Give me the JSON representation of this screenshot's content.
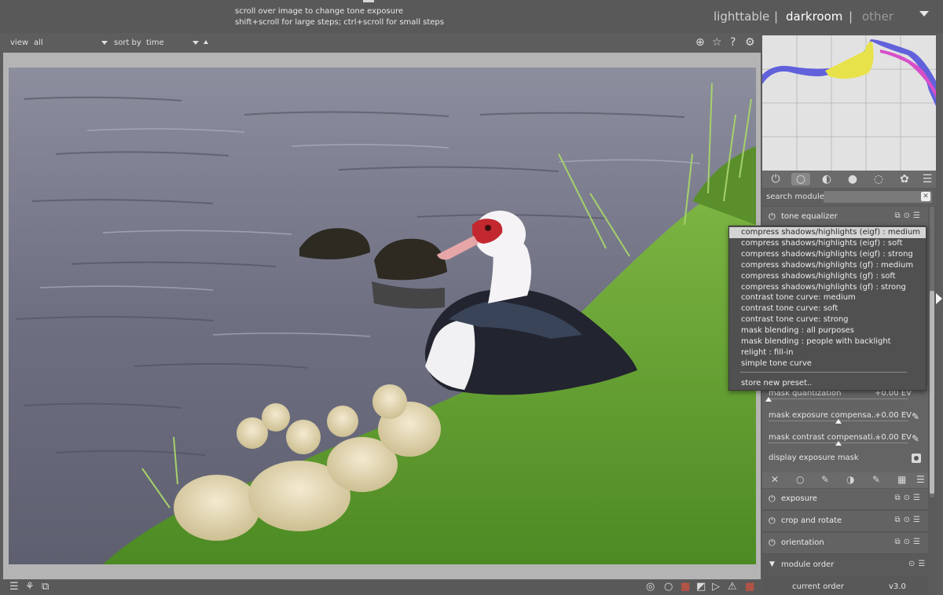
{
  "tooltip": {
    "line1": "scroll over image to change tone exposure",
    "line2": "shift+scroll for large steps; ctrl+scroll for small steps"
  },
  "views": {
    "lighttable": "lighttable",
    "separator": "|",
    "darkroom": "darkroom",
    "other": "other"
  },
  "filterbar": {
    "view_label": "view",
    "view_value": "all",
    "sort_label": "sort by",
    "sort_value": "time",
    "icons": [
      "grouping-icon",
      "star-icon",
      "help-icon",
      "gear-icon"
    ]
  },
  "search": {
    "label": "search module",
    "placeholder": ""
  },
  "module_group_icons": [
    "power-icon",
    "circle-icon",
    "gradient-icon",
    "color-wheel-icon",
    "correct-icon",
    "effect-icon",
    "menu-icon"
  ],
  "active_module": {
    "name": "tone equalizer"
  },
  "presets": [
    "compress shadows/highlights (eigf) : medium",
    "compress shadows/highlights (eigf) : soft",
    "compress shadows/highlights (eigf) : strong",
    "compress shadows/highlights (gf) : medium",
    "compress shadows/highlights (gf) : soft",
    "compress shadows/highlights (gf) : strong",
    "contrast tone curve: medium",
    "contrast tone curve: soft",
    "contrast tone curve: strong",
    "mask blending : all purposes",
    "mask blending : people with backlight",
    "relight : fill-in",
    "simple tone curve"
  ],
  "presets_selected_index": 0,
  "store_preset": "store new preset..",
  "params": [
    {
      "label": "mask quantization",
      "value": "+0.00 EV",
      "level": 0.0
    },
    {
      "label": "mask exposure compensa...",
      "value": "+0.00 EV",
      "level": 0.5
    },
    {
      "label": "mask contrast compensati...",
      "value": "+0.00 EV",
      "level": 0.5
    }
  ],
  "display_mask": "display exposure mask",
  "modules": [
    {
      "name": "exposure"
    },
    {
      "name": "crop and rotate"
    },
    {
      "name": "orientation"
    }
  ],
  "module_order": {
    "title": "module order",
    "current_label": "current order",
    "current_value": "v3.0"
  },
  "colors": {
    "selected_preset_bg": "#d4d4d4",
    "histogram_yellow": "#e8e24a",
    "histogram_blue": "#5a5adb",
    "histogram_magenta": "#d64fc9"
  }
}
